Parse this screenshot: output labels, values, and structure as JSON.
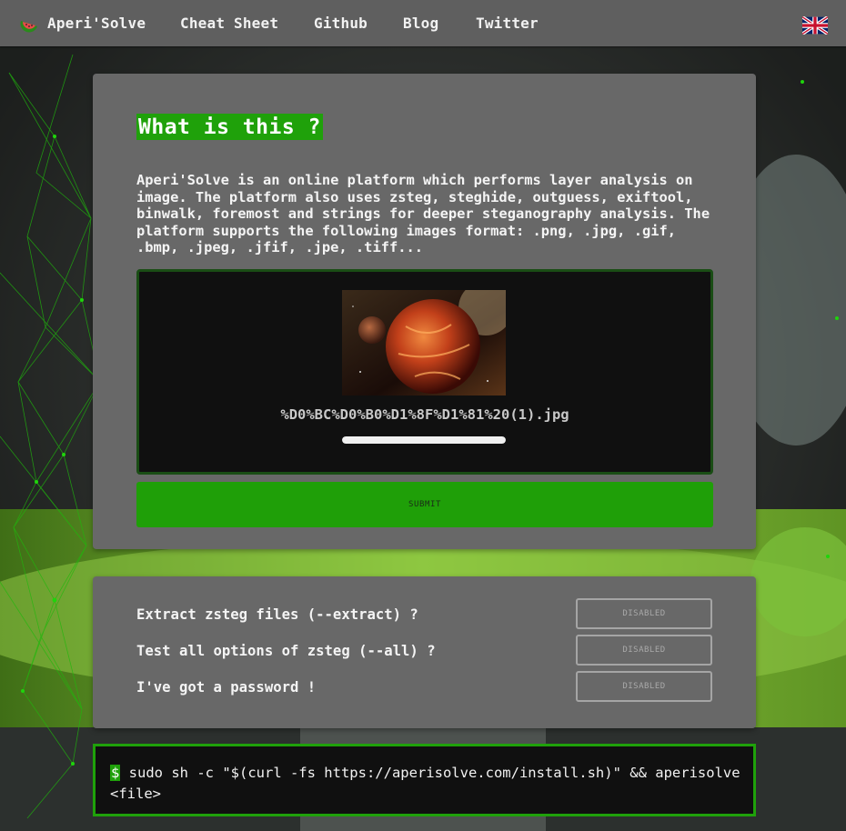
{
  "nav": {
    "brand": "Aperi'Solve",
    "items": [
      {
        "label": "Cheat Sheet"
      },
      {
        "label": "Github"
      },
      {
        "label": "Blog"
      },
      {
        "label": "Twitter"
      }
    ],
    "brand_icon": "watermelon-icon",
    "language_icon": "uk-flag-icon"
  },
  "main": {
    "title": "What is this ?",
    "description": "Aperi'Solve is an online platform which performs layer analysis on image. The platform also uses zsteg, steghide, outguess, exiftool, binwalk, foremost and strings for deeper steganography analysis. The platform supports the following images format: .png, .jpg, .gif, .bmp, .jpeg, .jfif, .jpe, .tiff...",
    "upload": {
      "filename": "%D0%BC%D0%B0%D1%8F%D1%81%20(1).jpg",
      "progress_percent": 100
    },
    "submit_label": "SUBMIT"
  },
  "options": [
    {
      "label": "Extract zsteg files (--extract) ?",
      "state": "DISABLED"
    },
    {
      "label": "Test all options of zsteg (--all) ?",
      "state": "DISABLED"
    },
    {
      "label": "I've got a password !",
      "state": "DISABLED"
    }
  ],
  "terminal": {
    "prompt": "$",
    "command": " sudo sh -c \"$(curl -fs https://aperisolve.com/install.sh)\" && aperisolve <file>"
  },
  "colors": {
    "accent": "#1fa10a",
    "card": "#686868",
    "nav": "#5f5f5f",
    "terminal_bg": "#101010"
  }
}
